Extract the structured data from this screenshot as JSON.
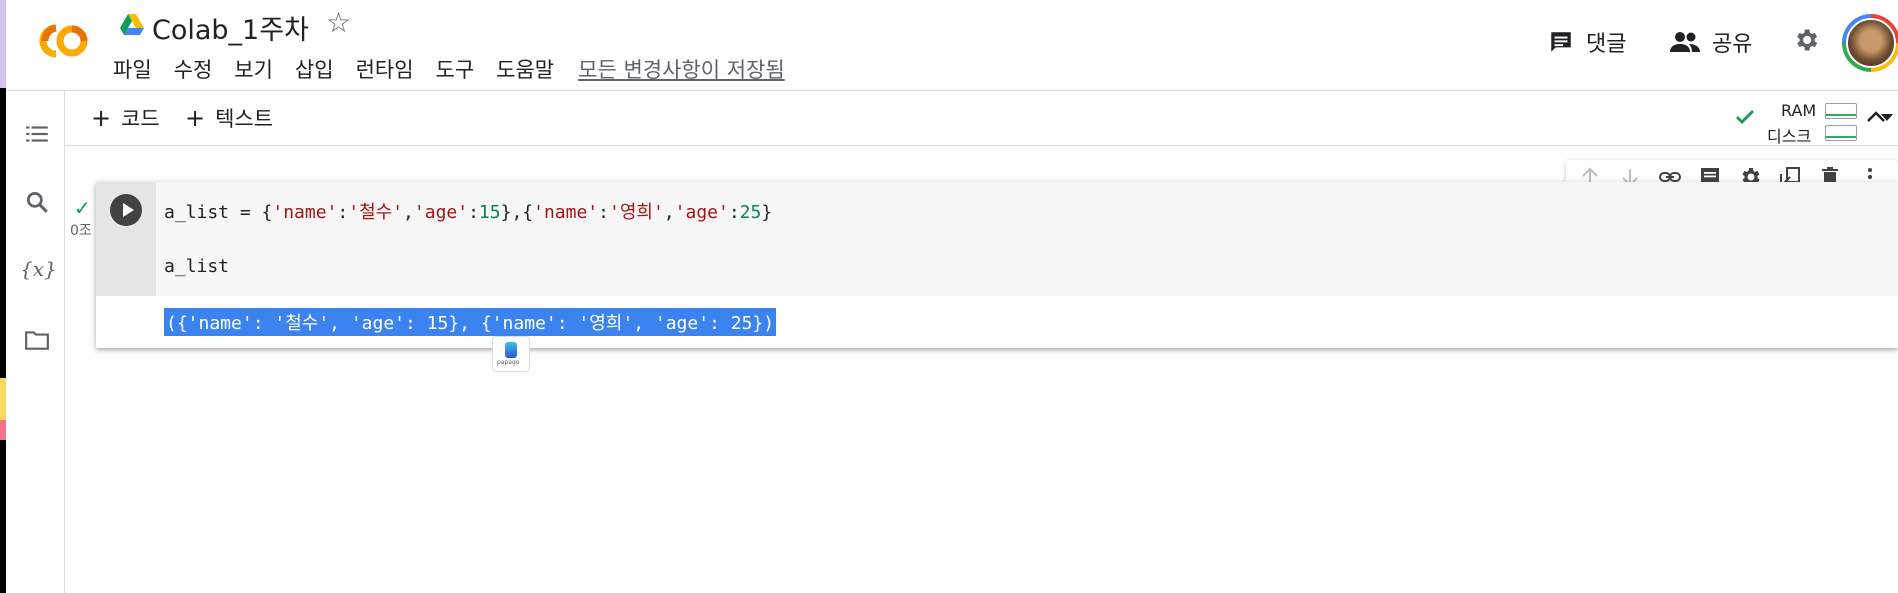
{
  "header": {
    "title": "Colab_1주차",
    "menu": [
      "파일",
      "수정",
      "보기",
      "삽입",
      "런타임",
      "도구",
      "도움말"
    ],
    "saved_status": "모든 변경사항이 저장됨",
    "comment_label": "댓글",
    "share_label": "공유"
  },
  "toolbar": {
    "add_code_label": "코드",
    "add_text_label": "텍스트",
    "ram_label": "RAM",
    "disk_label": "디스크"
  },
  "cell": {
    "exec_time": "0조",
    "code_line1": {
      "p1": "a_list = {",
      "s1": "'name'",
      "p2": ":",
      "s2": "'철수'",
      "p3": ",",
      "s3": "'age'",
      "p4": ":",
      "n1": "15",
      "p5": "},{",
      "s4": "'name'",
      "p6": ":",
      "s5": "'영희'",
      "p7": ",",
      "s6": "'age'",
      "p8": ":",
      "n2": "25",
      "p9": "}"
    },
    "code_line2": "a_list",
    "output": "({'name': '철수', 'age': 15}, {'name': '영희', 'age': 25})",
    "papago_label": "papago"
  },
  "colors": {
    "selection": "#3b84f0",
    "string": "#a31515",
    "number": "#098658",
    "success": "#0f9d58"
  }
}
